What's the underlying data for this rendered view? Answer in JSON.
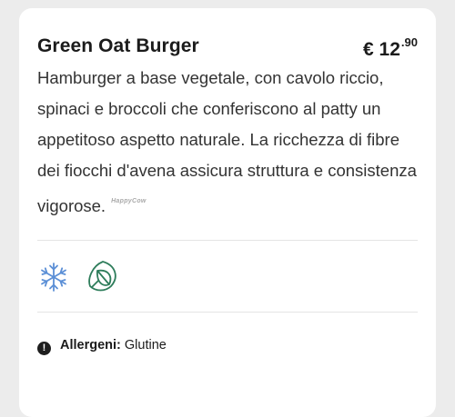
{
  "product": {
    "name": "Green Oat Burger",
    "price_main": "€ 12",
    "price_cents": ".90",
    "description": "Hamburger a base vegetale, con cavolo riccio, spinaci e broccoli che conferiscono al patty un appetitoso aspetto naturale. La ricchezza di fibre dei fiocchi d'avena assicura struttura e consistenza vigorose.",
    "watermark": "HappyCow"
  },
  "icons": [
    "snowflake-icon",
    "vegan-leaf-icon"
  ],
  "colors": {
    "snowflake": "#5b8fd6",
    "leaf": "#2e7d5b"
  },
  "allergens": {
    "label": "Allergeni:",
    "value": "Glutine"
  }
}
